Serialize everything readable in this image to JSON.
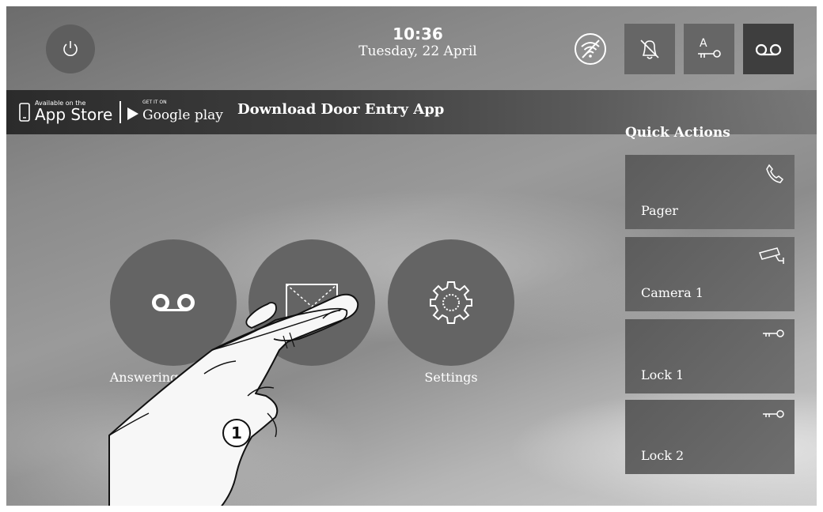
{
  "clock": {
    "time": "10:36",
    "date": "Tuesday, 22 April"
  },
  "status_icons": [
    "wifi-off-icon",
    "do-not-disturb-bell-icon",
    "auto-door-key-icon",
    "voicemail-icon"
  ],
  "auto_door_letter": "A",
  "app_bar": {
    "appstore_small": "Available on the",
    "appstore_big": "App Store",
    "googleplay_small": "GET IT ON",
    "googleplay_big": "Google play",
    "download_text": "Download Door Entry App"
  },
  "main_menu": [
    {
      "label": "Answering machine",
      "icon": "voicemail-icon"
    },
    {
      "label": "",
      "icon": "envelope-icon"
    },
    {
      "label": "Settings",
      "icon": "gear-icon"
    }
  ],
  "quick_actions": {
    "title": "Quick Actions",
    "items": [
      {
        "label": "Pager",
        "icon": "phone-icon"
      },
      {
        "label": "Camera 1",
        "icon": "camera-icon"
      },
      {
        "label": "Lock 1",
        "icon": "key-icon"
      },
      {
        "label": "Lock 2",
        "icon": "key-icon"
      }
    ]
  },
  "step_badge": "1",
  "colors": {
    "card": "#666666",
    "circle": "#646464",
    "active_status": "#3e3e3e"
  }
}
